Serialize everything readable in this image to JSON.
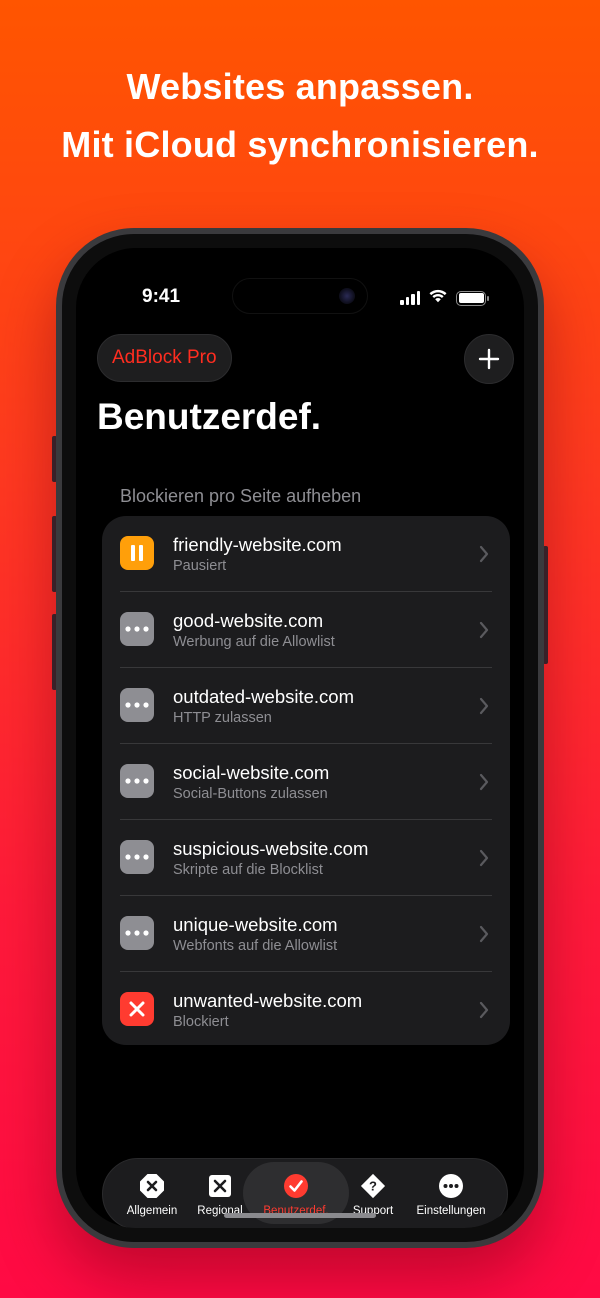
{
  "headline": {
    "line1": "Websites anpassen.",
    "line2": "Mit iCloud synchronisieren."
  },
  "status_bar": {
    "time": "9:41",
    "icons": [
      "cellular-signal-icon",
      "wifi-icon",
      "battery-icon"
    ]
  },
  "top_bar": {
    "app_name": "AdBlock Pro",
    "add_icon": "plus-icon"
  },
  "page_title": "Benutzerdef.",
  "section_header": "Blockieren pro Seite aufheben",
  "sites": [
    {
      "domain": "friendly-website.com",
      "status": "Pausiert",
      "icon": "pause-icon",
      "color": "#ff9f0a"
    },
    {
      "domain": "good-website.com",
      "status": "Werbung auf die Allowlist",
      "icon": "ellipsis-icon",
      "color": "#8e8e93"
    },
    {
      "domain": "outdated-website.com",
      "status": "HTTP zulassen",
      "icon": "ellipsis-icon",
      "color": "#8e8e93"
    },
    {
      "domain": "social-website.com",
      "status": "Social-Buttons zulassen",
      "icon": "ellipsis-icon",
      "color": "#8e8e93"
    },
    {
      "domain": "suspicious-website.com",
      "status": "Skripte auf die Blocklist",
      "icon": "ellipsis-icon",
      "color": "#8e8e93"
    },
    {
      "domain": "unique-website.com",
      "status": "Webfonts auf die Allowlist",
      "icon": "ellipsis-icon",
      "color": "#8e8e93"
    },
    {
      "domain": "unwanted-website.com",
      "status": "Blockiert",
      "icon": "xmark-icon",
      "color": "#ff3b30"
    }
  ],
  "tabs": [
    {
      "label": "Allgemein",
      "icon": "octagon-x-icon",
      "active": false
    },
    {
      "label": "Regional",
      "icon": "square-x-icon",
      "active": false
    },
    {
      "label": "Benutzerdef.",
      "icon": "checkmark-circle-icon",
      "active": true
    },
    {
      "label": "Support",
      "icon": "diamond-question-icon",
      "active": false
    },
    {
      "label": "Einstellungen",
      "icon": "ellipsis-circle-icon",
      "active": false
    }
  ],
  "colors": {
    "accent": "#ff3b30",
    "background_top": "#ff5500",
    "background_bottom": "#ff0a44"
  }
}
